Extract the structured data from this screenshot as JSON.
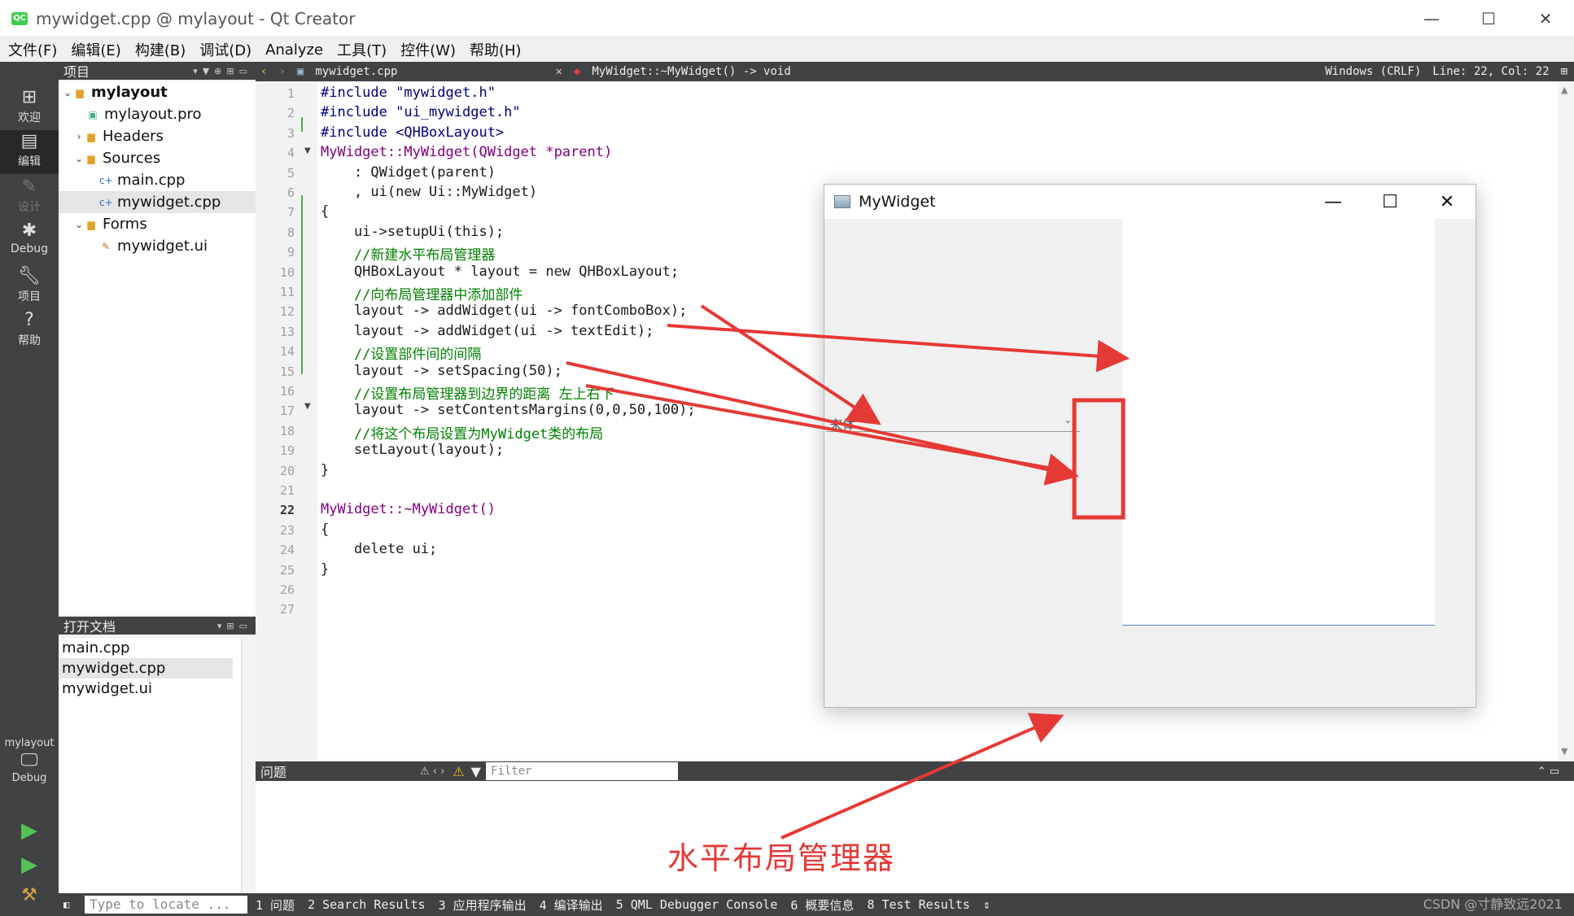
{
  "window": {
    "title": "mywidget.cpp @ mylayout - Qt Creator",
    "logo": "QC"
  },
  "menu": [
    "文件(F)",
    "编辑(E)",
    "构建(B)",
    "调试(D)",
    "Analyze",
    "工具(T)",
    "控件(W)",
    "帮助(H)"
  ],
  "modes": [
    {
      "label": "欢迎",
      "icon": "grid-icon"
    },
    {
      "label": "编辑",
      "icon": "edit-icon"
    },
    {
      "label": "设计",
      "icon": "pencil-icon"
    },
    {
      "label": "Debug",
      "icon": "bug-icon"
    },
    {
      "label": "项目",
      "icon": "wrench-icon"
    },
    {
      "label": "帮助",
      "icon": "help-icon"
    }
  ],
  "kit": {
    "project": "mylayout",
    "config": "Debug"
  },
  "project_panel": {
    "title": "项目",
    "tree": [
      {
        "label": "mylayout",
        "level": 0,
        "expanded": true,
        "bold": true
      },
      {
        "label": "mylayout.pro",
        "level": 1
      },
      {
        "label": "Headers",
        "level": 1,
        "expanded": false
      },
      {
        "label": "Sources",
        "level": 1,
        "expanded": true
      },
      {
        "label": "main.cpp",
        "level": 2
      },
      {
        "label": "mywidget.cpp",
        "level": 2,
        "selected": true
      },
      {
        "label": "Forms",
        "level": 1,
        "expanded": true
      },
      {
        "label": "mywidget.ui",
        "level": 2
      }
    ]
  },
  "open_docs": {
    "title": "打开文档",
    "items": [
      "main.cpp",
      "mywidget.cpp",
      "mywidget.ui"
    ],
    "selected": 1
  },
  "editor": {
    "file": "mywidget.cpp",
    "symbol": "MyWidget::~MyWidget() -> void",
    "encoding": "Windows (CRLF)",
    "position": "Line: 22, Col: 22",
    "line_numbers": [
      "1",
      "2",
      "3",
      "4",
      "5",
      "6",
      "7",
      "8",
      "9",
      "10",
      "11",
      "12",
      "13",
      "14",
      "15",
      "16",
      "17",
      "18",
      "19",
      "20",
      "21",
      "22",
      "23",
      "24",
      "25",
      "26",
      "27"
    ],
    "lines": [
      "#include \"mywidget.h\"",
      "#include \"ui_mywidget.h\"",
      "#include <QHBoxLayout>",
      "MyWidget::MyWidget(QWidget *parent)",
      "    : QWidget(parent)",
      "    , ui(new Ui::MyWidget)",
      "{",
      "    ui->setupUi(this);",
      "    //新建水平布局管理器",
      "    QHBoxLayout * layout = new QHBoxLayout;",
      "    //向布局管理器中添加部件",
      "    layout -> addWidget(ui -> fontComboBox);",
      "    layout -> addWidget(ui -> textEdit);",
      "    //设置部件间的间隔",
      "    layout -> setSpacing(50);",
      "    //设置布局管理器到边界的距离 左上右下",
      "    layout -> setContentsMargins(0,0,50,100);",
      "    //将这个布局设置为MyWidget类的布局",
      "    setLayout(layout);",
      "}",
      "",
      "MyWidget::~MyWidget()",
      "{",
      "    delete ui;",
      "}",
      "",
      ""
    ]
  },
  "issues": {
    "title": "问题",
    "filter_placeholder": "Filter"
  },
  "status": {
    "locator_placeholder": "Type to locate ...",
    "tabs": [
      "1 问题",
      "2 Search Results",
      "3 应用程序输出",
      "4 编译输出",
      "5 QML Debugger Console",
      "6 概要信息",
      "8 Test Results"
    ]
  },
  "mywidget_window": {
    "title": "MyWidget",
    "combo_value": "宋体"
  },
  "annotation": {
    "label": "水平布局管理器",
    "color": "#e53935"
  },
  "watermark": "CSDN @寸静致远2021"
}
